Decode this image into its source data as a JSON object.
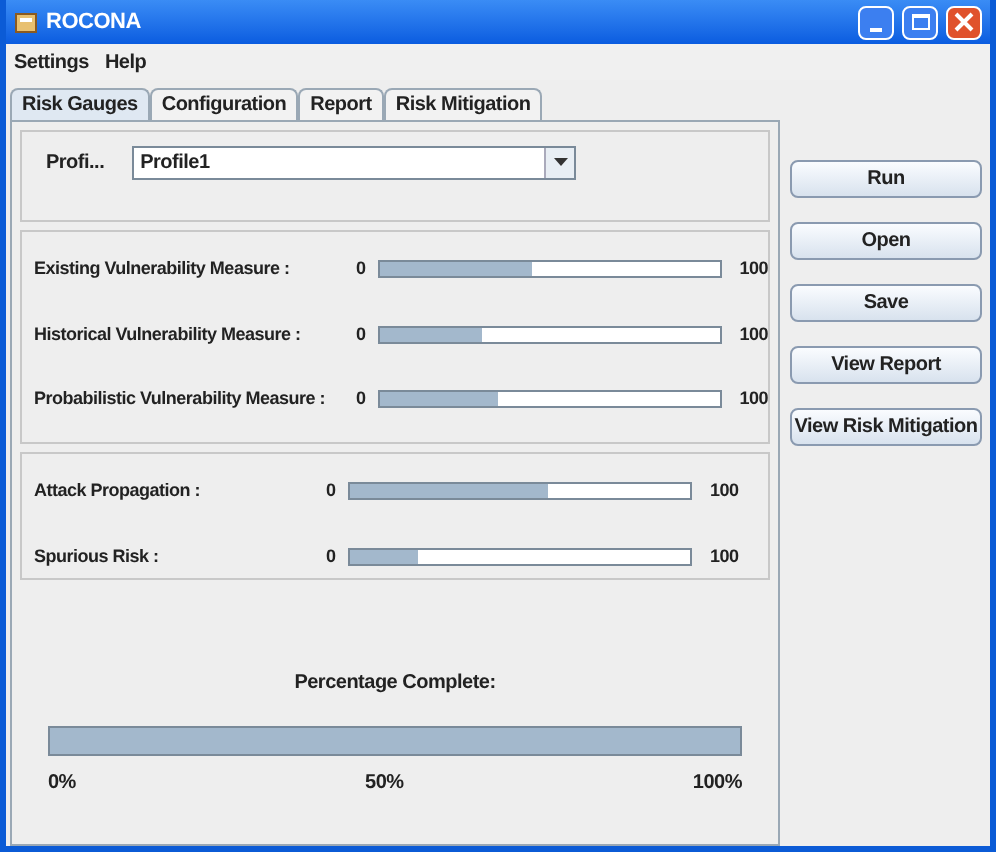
{
  "window": {
    "title": "ROCONA"
  },
  "menu": [
    "Settings",
    "Help"
  ],
  "tabs": [
    {
      "label": "Risk Gauges",
      "selected": true
    },
    {
      "label": "Configuration",
      "selected": false
    },
    {
      "label": "Report",
      "selected": false
    },
    {
      "label": "Risk Mitigation",
      "selected": false
    }
  ],
  "profile": {
    "label": "Profi...",
    "value": "Profile1"
  },
  "gauge_groups": [
    [
      {
        "name": "Existing Vulnerability Measure :",
        "min": "0",
        "max": "100",
        "level": 0.45
      },
      {
        "name": "Historical Vulnerability Measure :",
        "min": "0",
        "max": "100",
        "level": 0.3
      },
      {
        "name": "Probabilistic Vulnerability Measure :",
        "min": "0",
        "max": "100",
        "level": 0.35
      }
    ],
    [
      {
        "name": "Attack Propagation :",
        "min": "0",
        "max": "100",
        "level": 0.58
      },
      {
        "name": "Spurious Risk :",
        "min": "0",
        "max": "100",
        "level": 0.2
      }
    ]
  ],
  "progress": {
    "label": "Percentage Complete:",
    "level": 1,
    "ticks": [
      "0%",
      "50%",
      "100%"
    ]
  },
  "buttons": [
    "Run",
    "Open",
    "Save",
    "View Report",
    "View Risk Mitigation"
  ]
}
